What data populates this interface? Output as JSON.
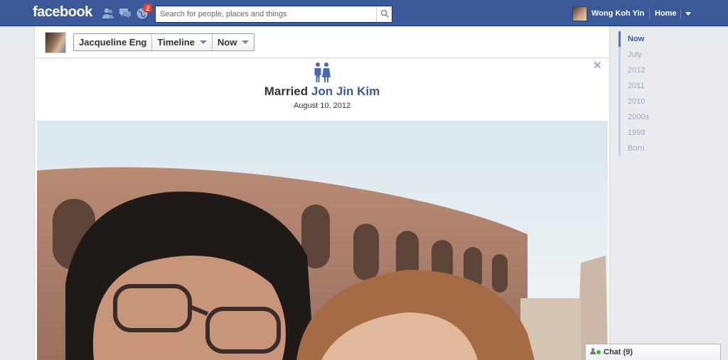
{
  "topbar": {
    "logo": "facebook",
    "jewels": [
      {
        "icon": "friend-requests-icon"
      },
      {
        "icon": "messages-icon"
      },
      {
        "icon": "notifications-icon",
        "badge": "2"
      }
    ],
    "search": {
      "placeholder": "Search for people, places and things",
      "icon": "search-icon"
    },
    "user_name": "Wong Koh Yin",
    "home_label": "Home"
  },
  "timeline_header": {
    "profile_name": "Jacqueline Eng",
    "section": "Timeline",
    "period": "Now"
  },
  "life_event": {
    "icon": "married-couple-icon",
    "prefix": "Married",
    "partner": "Jon Jin Kim",
    "date": "August 10, 2012"
  },
  "timeline_nav": {
    "items": [
      "Now",
      "July",
      "2012",
      "2011",
      "2010",
      "2000s",
      "1998",
      "Born"
    ],
    "active": "Now"
  },
  "chat": {
    "label": "Chat (9)"
  },
  "colors": {
    "brand_blue": "#3b5998",
    "link_blue": "#3b5998",
    "muted_nav": "#9aa9c7",
    "badge_red": "#f03d25",
    "online_green": "#42b72a"
  }
}
